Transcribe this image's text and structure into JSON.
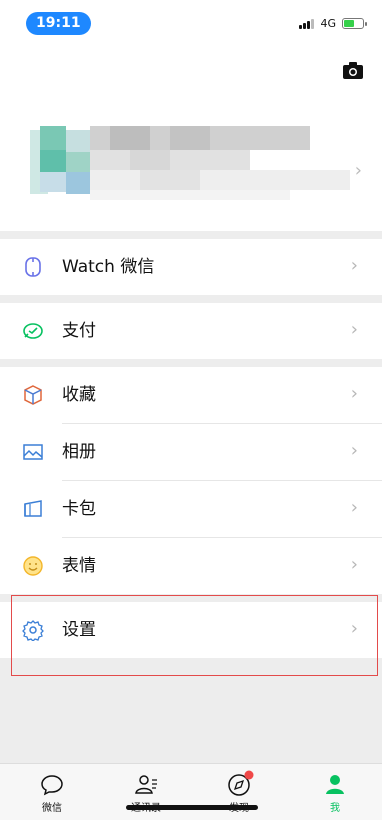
{
  "status_bar": {
    "time": "19:11",
    "network": "4G"
  },
  "menu": {
    "watch_label": "Watch 微信",
    "pay_label": "支付",
    "favorites_label": "收藏",
    "album_label": "相册",
    "cards_label": "卡包",
    "stickers_label": "表情",
    "settings_label": "设置"
  },
  "tabs": [
    {
      "label": "微信",
      "icon": "chat-icon"
    },
    {
      "label": "通讯录",
      "icon": "contacts-icon"
    },
    {
      "label": "发现",
      "icon": "compass-icon",
      "badge": true
    },
    {
      "label": "我",
      "icon": "me-icon",
      "active": true
    }
  ],
  "colors": {
    "accent_green": "#07c160",
    "badge_red": "#f04848",
    "status_blue": "#1e88ff",
    "highlight_red": "#e34b4b"
  }
}
